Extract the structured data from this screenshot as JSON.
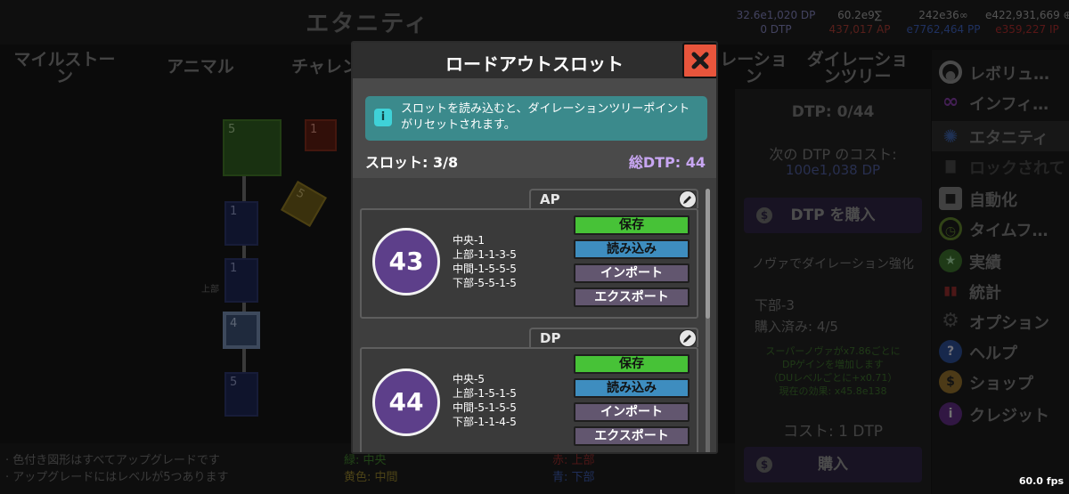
{
  "app": {
    "title": "エタニティ",
    "fps": "60.0 fps"
  },
  "resources": {
    "row1": [
      "32.6e1,020 DP",
      "60.2e9∑",
      "242e36∞",
      "e422,931,669 ⊕"
    ],
    "row2": [
      "0 DTP",
      "437,017 AP",
      "e7762,464 PP",
      "e359,227 IP"
    ],
    "colors": {
      "dp": "#8a8ac0",
      "dtp": "#8a8ac0",
      "ap": "#c0443a",
      "pp": "#3a6ad0",
      "ip": "#c02a2a",
      "neutral": "#aaaaaa"
    }
  },
  "tabs": [
    {
      "label": "マイルストーン"
    },
    {
      "label": "アニマル"
    },
    {
      "label": "チャレン"
    },
    {
      "label": "レーショ\nン"
    },
    {
      "label": "ダイレーショ\nンツリー"
    }
  ],
  "tree": {
    "nodes": [
      "5",
      "1",
      "5",
      "1",
      "1",
      "4",
      "5"
    ],
    "side_label": "上部"
  },
  "footer_notes": {
    "left": [
      "· 色付き図形はすべてアップグレードです",
      "· アップグレードにはレベルが5つあります"
    ],
    "legend": [
      "緑: 中央",
      "黄色: 中間",
      "赤: 上部",
      "青: 下部"
    ]
  },
  "right_panel": {
    "dtp": "DTP: 0/44",
    "next_cost_label": "次の DTP のコスト:",
    "next_cost_value": "100e1,038 DP",
    "buy_dtp": "DTP を購入",
    "section_title": "ノヴァでダイレーション強化",
    "upgrade_name": "下部-3",
    "purchased": "購入済み: 4/5",
    "desc": [
      "スーパーノヴァがx7.86ごとに",
      "DPゲインを増加します",
      "（DUレベルごとに+x0.71）",
      "現在の効果: x45.8e138"
    ],
    "cost": "コスト: 1 DTP",
    "buy": "購入"
  },
  "side_menu": [
    {
      "icon": "rebirth-icon",
      "label": "レボリュ…"
    },
    {
      "icon": "infinity-icon",
      "label": "インフィ…"
    },
    {
      "icon": "eternity-icon",
      "label": "エタニティ"
    },
    {
      "icon": "lock-icon",
      "label": "ロックされて"
    },
    {
      "icon": "robot-icon",
      "label": "自動化"
    },
    {
      "icon": "clock-icon",
      "label": "タイムフ…"
    },
    {
      "icon": "star-icon",
      "label": "実績"
    },
    {
      "icon": "bars-icon",
      "label": "統計"
    },
    {
      "icon": "gear-icon",
      "label": "オプション"
    },
    {
      "icon": "help-icon",
      "label": "ヘルプ"
    },
    {
      "icon": "bag-icon",
      "label": "ショップ"
    },
    {
      "icon": "info-icon",
      "label": "クレジット"
    }
  ],
  "modal": {
    "title": "ロードアウトスロット",
    "info": "スロットを読み込むと、ダイレーションツリーポイントがリセットされます。",
    "slot_count": "スロット: 3/8",
    "total_dtp": "総DTP: 44",
    "slots": [
      {
        "name": "AP",
        "points": "43",
        "lines": [
          "中央-1",
          "上部-1-1-3-5",
          "中間-1-5-5-5",
          "下部-5-5-1-5"
        ],
        "save": "保存",
        "load": "読み込み",
        "import": "インポート",
        "export": "エクスポート"
      },
      {
        "name": "DP",
        "points": "44",
        "lines": [
          "中央-5",
          "上部-1-5-1-5",
          "中間-5-1-5-5",
          "下部-1-1-4-5"
        ],
        "save": "保存",
        "load": "読み込み",
        "import": "インポート",
        "export": "エクスポート"
      }
    ]
  }
}
